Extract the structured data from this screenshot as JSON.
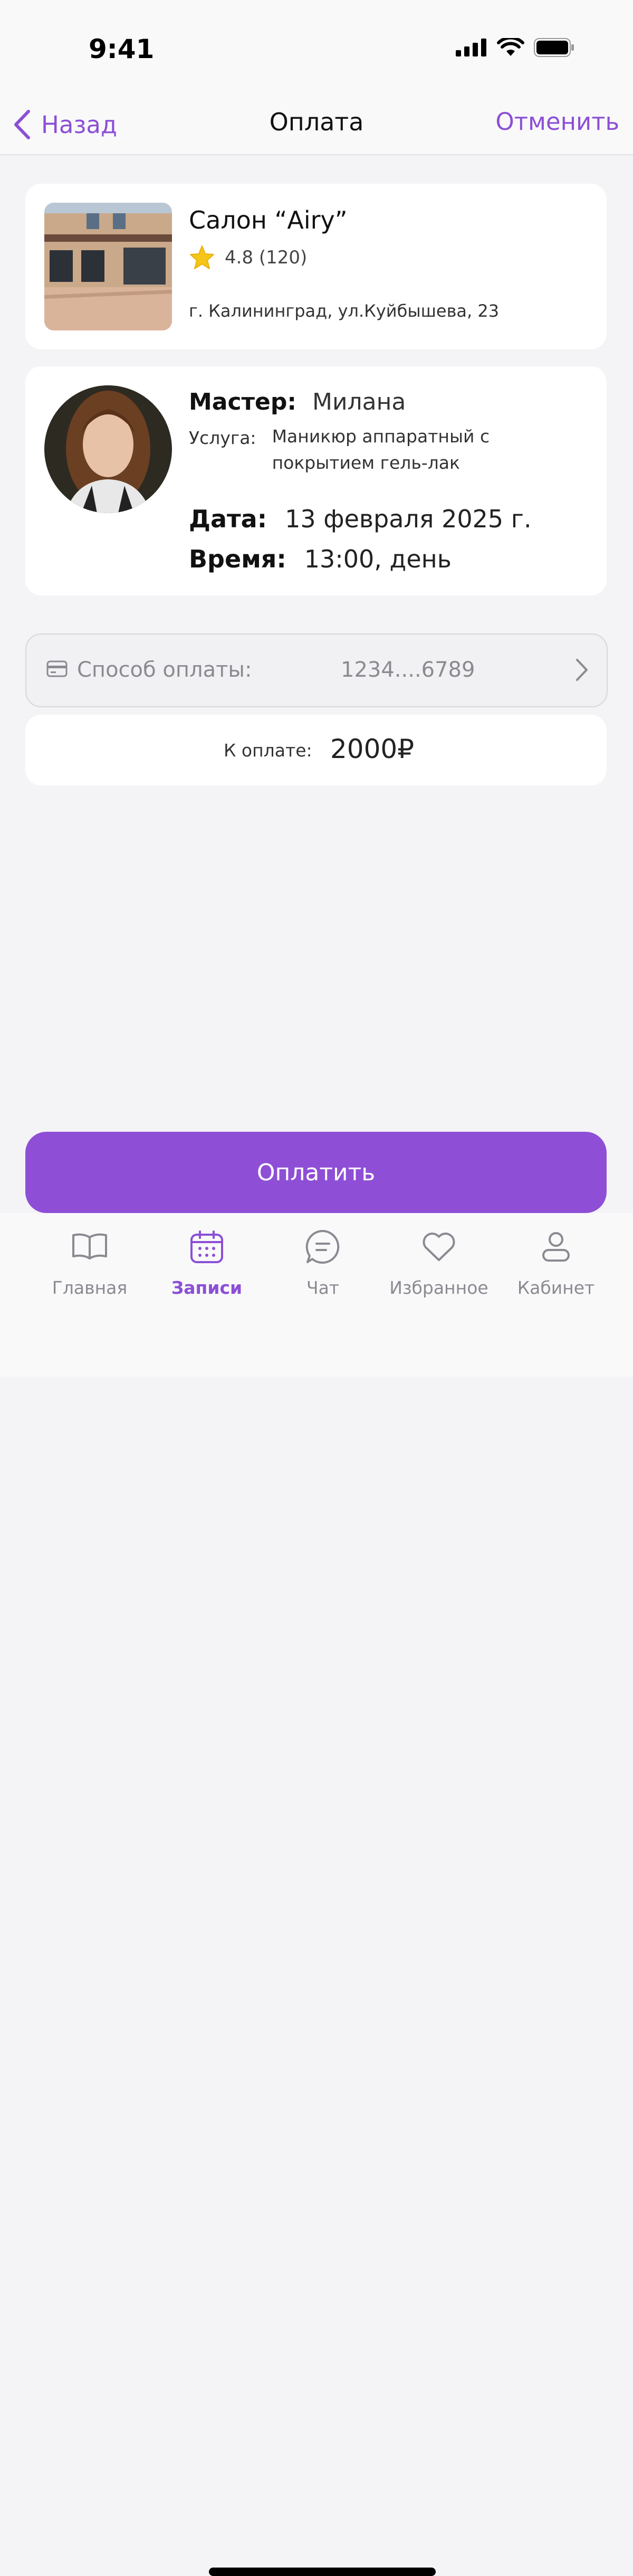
{
  "status_bar": {
    "time": "9:41"
  },
  "nav": {
    "back_label": "Назад",
    "title": "Оплата",
    "cancel_label": "Отменить"
  },
  "salon": {
    "name": "Салон “Airy”",
    "rating": "4.8 (120)",
    "address": "г. Калининград, ул.Куйбышева, 23"
  },
  "booking": {
    "master_label": "Мастер:",
    "master_value": "Милана",
    "service_label": "Услуга:",
    "service_value": "Маникюр аппаратный с покрытием гель-лак",
    "date_label": "Дата:",
    "date_value": "13 февраля 2025 г.",
    "time_label": "Время:",
    "time_value": "13:00, день"
  },
  "payment": {
    "method_label": "Способ оплаты:",
    "card_value": "1234....6789",
    "total_label": "К оплате:",
    "total_value": "2000₽",
    "pay_button": "Оплатить"
  },
  "tabs": [
    {
      "label": "Главная",
      "icon": "book-icon",
      "active": false
    },
    {
      "label": "Записи",
      "icon": "calendar-icon",
      "active": true
    },
    {
      "label": "Чат",
      "icon": "chat-icon",
      "active": false
    },
    {
      "label": "Избранное",
      "icon": "heart-icon",
      "active": false
    },
    {
      "label": "Кабинет",
      "icon": "profile-icon",
      "active": false
    }
  ],
  "colors": {
    "accent": "#8e4fd6",
    "background": "#f4f4f6",
    "star": "#f5c518"
  }
}
